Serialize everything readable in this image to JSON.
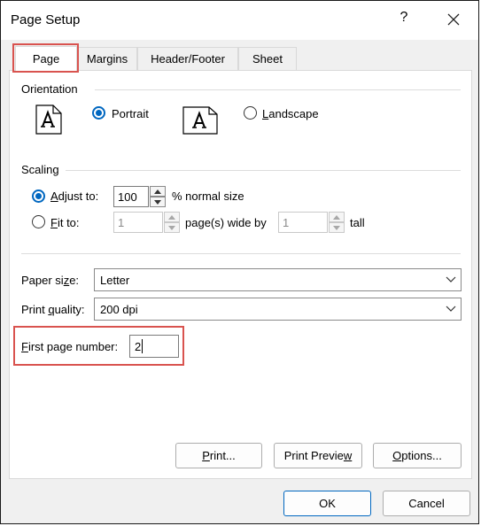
{
  "window": {
    "title": "Page Setup"
  },
  "tabs": [
    {
      "label": "Page",
      "active": true
    },
    {
      "label": "Margins",
      "active": false
    },
    {
      "label": "Header/Footer",
      "active": false
    },
    {
      "label": "Sheet",
      "active": false
    }
  ],
  "orientation": {
    "group_label": "Orientation",
    "portrait_label": "Portrait",
    "landscape_label": "Landscape",
    "selected": "Portrait"
  },
  "scaling": {
    "group_label": "Scaling",
    "adjust_to_label": "Adjust to:",
    "adjust_to_value": "100",
    "normal_size_label": "% normal size",
    "fit_to_label": "Fit to:",
    "fit_pages_wide_value": "1",
    "pages_wide_label": "page(s) wide by",
    "fit_pages_tall_value": "1",
    "tall_label": "tall",
    "selected": "Adjust to"
  },
  "paper_size": {
    "label": "Paper size:",
    "value": "Letter"
  },
  "print_quality": {
    "label": "Print quality:",
    "value": "200 dpi"
  },
  "first_page_number": {
    "label": "First page number:",
    "value": "2"
  },
  "buttons": {
    "print": "Print...",
    "print_preview": "Print Preview",
    "options": "Options...",
    "ok": "OK",
    "cancel": "Cancel"
  },
  "colors": {
    "accent": "#0067c0",
    "highlight": "#d9534f"
  }
}
